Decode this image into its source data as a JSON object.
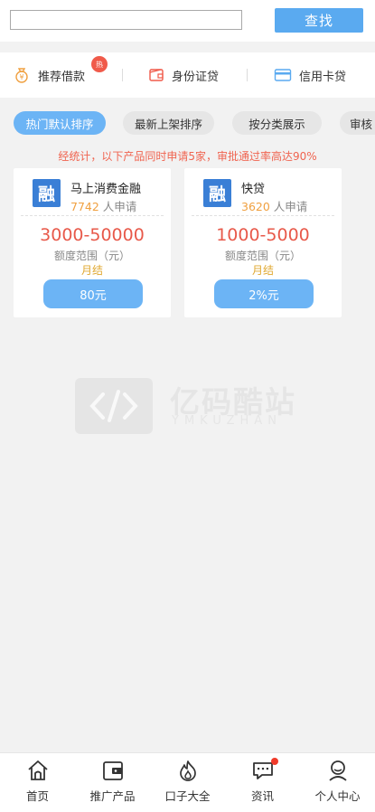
{
  "search": {
    "placeholder": "",
    "value": "",
    "button_label": "查找"
  },
  "categories": [
    {
      "label": "推荐借款",
      "icon": "money-bag-icon",
      "badge": "热"
    },
    {
      "label": "身份证贷",
      "icon": "wallet-icon"
    },
    {
      "label": "信用卡贷",
      "icon": "credit-card-icon"
    }
  ],
  "sort_tabs": [
    {
      "label": "热门默认排序",
      "active": true
    },
    {
      "label": "最新上架排序",
      "active": false
    },
    {
      "label": "按分类展示",
      "active": false
    },
    {
      "label": "审核",
      "active": false
    }
  ],
  "notice": "经统计，以下产品同时申请5家，审批通过率高达90%",
  "products": [
    {
      "name": "马上消费金融",
      "applicants": "7742",
      "applicants_suffix": " 人申请",
      "range": "3000-50000",
      "range_label": "额度范围（元）",
      "term": "月结",
      "button_label": "80元",
      "logo_text": "融"
    },
    {
      "name": "快贷",
      "applicants": "3620",
      "applicants_suffix": " 人申请",
      "range": "1000-5000",
      "range_label": "额度范围（元）",
      "term": "月结",
      "button_label": "2%元",
      "logo_text": "融"
    }
  ],
  "watermark": {
    "title": "亿码酷站",
    "subtitle": "YMKUZHAN"
  },
  "tabbar": [
    {
      "label": "首页",
      "icon": "home-icon"
    },
    {
      "label": "推广产品",
      "icon": "wallet-card-icon"
    },
    {
      "label": "口子大全",
      "icon": "flame-icon"
    },
    {
      "label": "资讯",
      "icon": "message-icon",
      "dot": true
    },
    {
      "label": "个人中心",
      "icon": "user-icon"
    }
  ],
  "colors": {
    "accent": "#5aaaf0",
    "tab_active": "#6cb4f5",
    "notice": "#f06450",
    "range": "#e8594a",
    "term": "#e0a830",
    "applicant_num": "#f0a040",
    "badge": "#f05a4a"
  }
}
